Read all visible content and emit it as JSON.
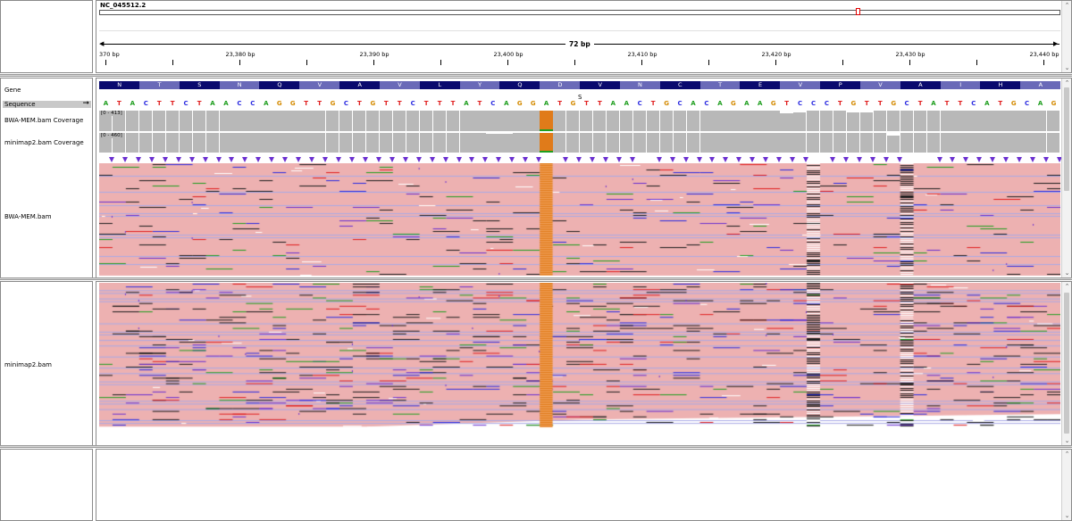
{
  "header": {
    "locus": "NC_045512.2",
    "span": "72 bp",
    "ruler_ticks": [
      {
        "label": "370 bp"
      },
      {
        "label": "23,380 bp"
      },
      {
        "label": "23,390 bp"
      },
      {
        "label": "23,400 bp"
      },
      {
        "label": "23,410 bp"
      },
      {
        "label": "23,420 bp"
      },
      {
        "label": "23,430 bp"
      },
      {
        "label": "23,440 bp"
      }
    ]
  },
  "tracks": {
    "gene": "Gene",
    "sequence": "Sequence",
    "bwa_coverage": "BWA-MEM.bam Coverage",
    "bwa_cov_range": "[0 - 413]",
    "mm2_coverage": "minimap2.bam Coverage",
    "mm2_cov_range": "[0 - 460]",
    "bwa_bam": "BWA-MEM.bam",
    "mm2_bam": "minimap2.bam"
  },
  "amino_acids": [
    "N",
    "T",
    "S",
    "N",
    "Q",
    "V",
    "A",
    "V",
    "L",
    "Y",
    "Q",
    "D",
    "V",
    "N",
    "C",
    "T",
    "E",
    "V",
    "P",
    "V",
    "A",
    "I",
    "H",
    "A"
  ],
  "variant_aa_label": "S",
  "sequence_bases": "ATACTTCTAACCAGGTTGCTGTTCTTTATCAGGATGTTAACTGCACAGAAGTCCCTGTTGCTATTCATGCAG",
  "colors": {
    "A": "#1e9e1e",
    "C": "#2a2ae0",
    "G": "#d48a00",
    "T": "#e01e1e",
    "aa_dark": "#0a0a6e",
    "aa_light": "#6a6ab8",
    "read_fill": "#edb1b1",
    "variant": "#e07b1a",
    "insertion": "#6a2fd0"
  }
}
